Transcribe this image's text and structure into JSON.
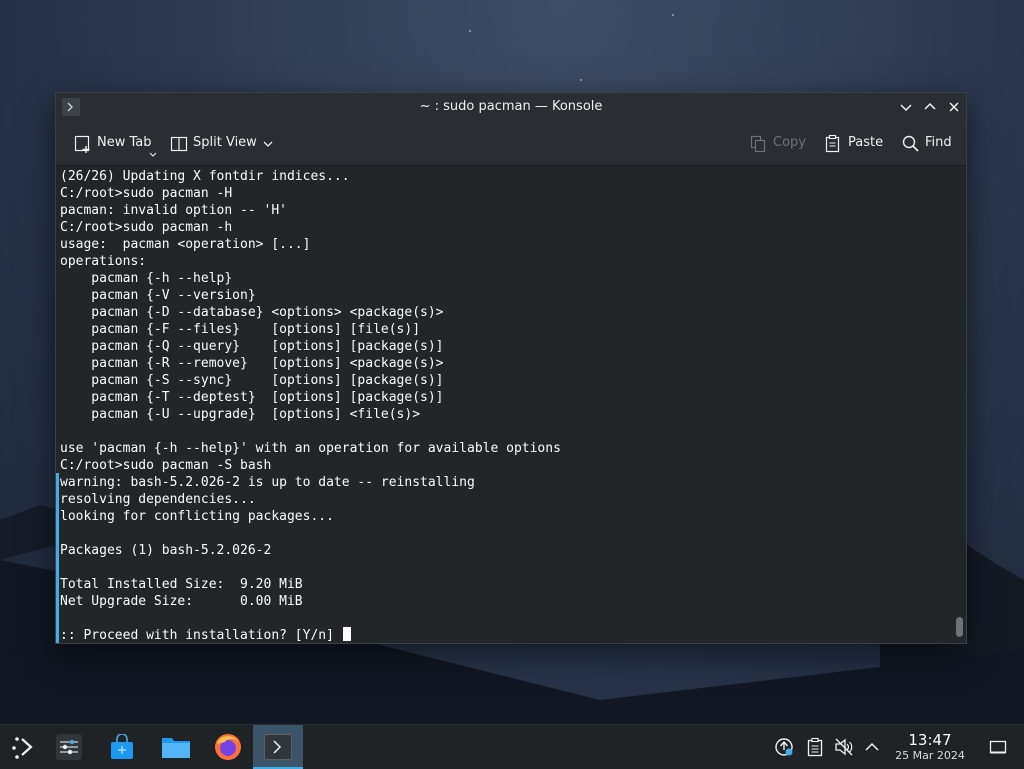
{
  "window": {
    "title": "~ : sudo pacman — Konsole"
  },
  "toolbar": {
    "new_tab": "New Tab",
    "split_view": "Split View",
    "copy": "Copy",
    "paste": "Paste",
    "find": "Find"
  },
  "terminal": {
    "lines": [
      "(26/26) Updating X fontdir indices...",
      "C:/root>sudo pacman -H",
      "pacman: invalid option -- 'H'",
      "C:/root>sudo pacman -h",
      "usage:  pacman <operation> [...]",
      "operations:",
      "    pacman {-h --help}",
      "    pacman {-V --version}",
      "    pacman {-D --database} <options> <package(s)>",
      "    pacman {-F --files}    [options] [file(s)]",
      "    pacman {-Q --query}    [options] [package(s)]",
      "    pacman {-R --remove}   [options] <package(s)>",
      "    pacman {-S --sync}     [options] [package(s)]",
      "    pacman {-T --deptest}  [options] [package(s)]",
      "    pacman {-U --upgrade}  [options] <file(s)>",
      "",
      "use 'pacman {-h --help}' with an operation for available options",
      "C:/root>sudo pacman -S bash",
      "warning: bash-5.2.026-2 is up to date -- reinstalling",
      "resolving dependencies...",
      "looking for conflicting packages...",
      "",
      "Packages (1) bash-5.2.026-2",
      "",
      "Total Installed Size:  9.20 MiB",
      "Net Upgrade Size:      0.00 MiB",
      ""
    ],
    "prompt": ":: Proceed with installation? [Y/n] "
  },
  "taskbar": {
    "apps": [
      {
        "name": "System Settings",
        "icon": "settings-sliders-icon"
      },
      {
        "name": "Discover",
        "icon": "discover-store-icon"
      },
      {
        "name": "Dolphin",
        "icon": "folder-icon"
      },
      {
        "name": "Firefox",
        "icon": "firefox-icon"
      },
      {
        "name": "Konsole",
        "icon": "terminal-icon",
        "active": true
      }
    ],
    "tray_icons": [
      "updates-icon",
      "clipboard-icon",
      "volume-muted-icon",
      "chevron-up-icon"
    ],
    "clock_time": "13:47",
    "clock_date": "25 Mar 2024"
  },
  "colors": {
    "accent": "#3daee9",
    "terminal_bg": "#232629",
    "terminal_fg": "#fcfcfc"
  }
}
